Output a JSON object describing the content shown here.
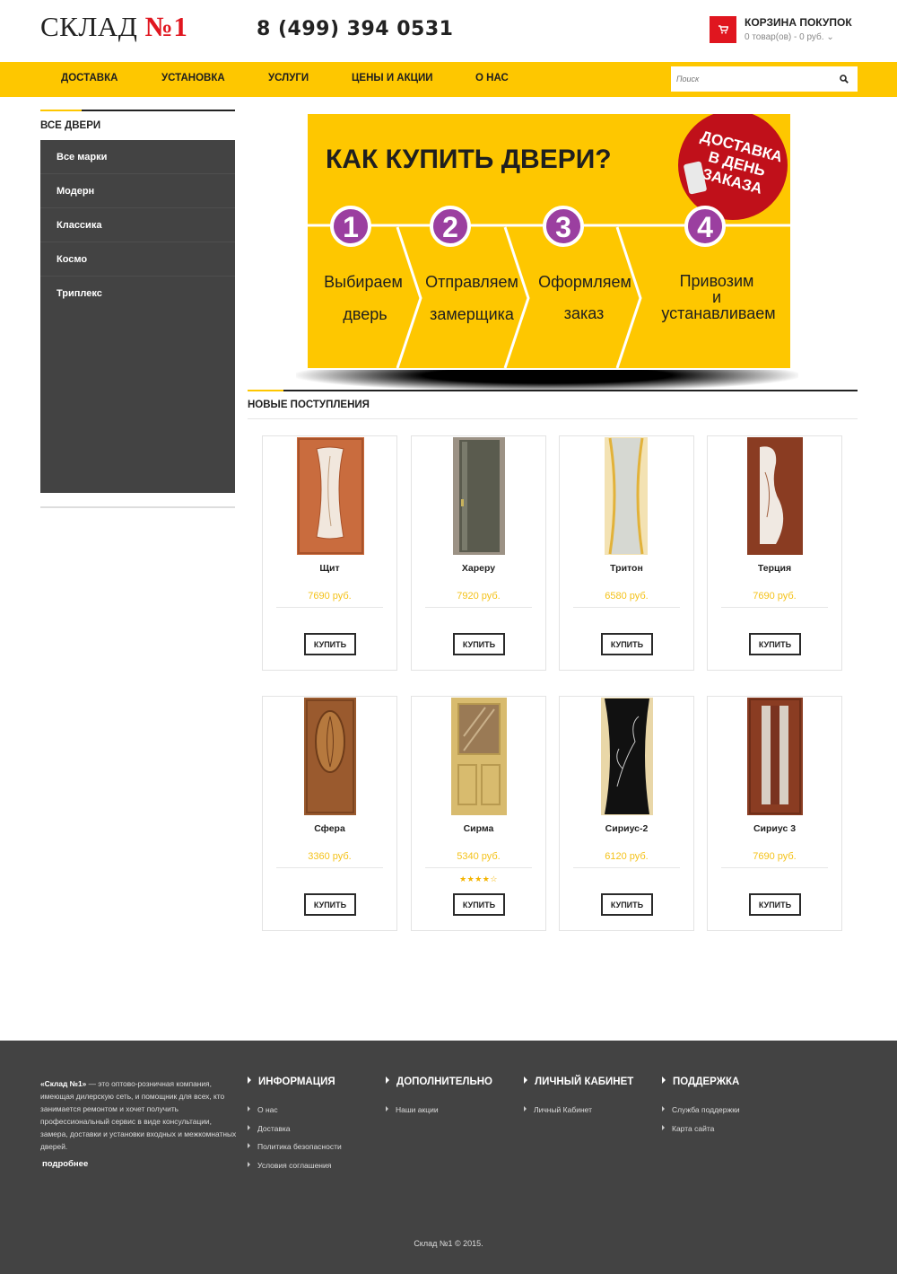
{
  "header": {
    "logo_text": "СКЛАД ",
    "logo_num": "№1",
    "phone": "8 (499) 394 0531",
    "cart_title": "КОРЗИНА ПОКУПОК",
    "cart_summary": "0 товар(ов) - 0 руб.",
    "cart_chevron": "⌄"
  },
  "nav": {
    "items": [
      "ДОСТАВКА",
      "УСТАНОВКА",
      "УСЛУГИ",
      "ЦЕНЫ И АКЦИИ",
      "О НАС"
    ],
    "search_placeholder": "Поиск",
    "search_icon": "search-icon"
  },
  "sidebar": {
    "title": "ВСЕ ДВЕРИ",
    "items": [
      "Все марки",
      "Модерн",
      "Классика",
      "Космо",
      "Триплекс"
    ]
  },
  "banner": {
    "title": "КАК КУПИТЬ ДВЕРИ?",
    "badge": [
      "ДОСТАВКА",
      "В ДЕНЬ",
      "ЗАКАЗА"
    ],
    "steps": [
      {
        "num": "1",
        "lines": [
          "Выбираем",
          "дверь"
        ]
      },
      {
        "num": "2",
        "lines": [
          "Отправляем",
          "замерщика"
        ]
      },
      {
        "num": "3",
        "lines": [
          "Оформляем",
          "заказ"
        ]
      },
      {
        "num": "4",
        "lines": [
          "Привозим",
          "и",
          "устанавливаем"
        ]
      }
    ],
    "colors": {
      "yellow": "#fec700",
      "purple": "#9b3fa0",
      "red": "#c0101a"
    }
  },
  "new_arrivals": {
    "title": "НОВЫЕ ПОСТУПЛЕНИЯ",
    "buy_label": "КУПИТЬ",
    "products": [
      {
        "name": "Щит",
        "price": "7690 руб.",
        "stars": ""
      },
      {
        "name": "Хареру",
        "price": "7920 руб.",
        "stars": ""
      },
      {
        "name": "Тритон",
        "price": "6580 руб.",
        "stars": ""
      },
      {
        "name": "Терция",
        "price": "7690 руб.",
        "stars": ""
      },
      {
        "name": "Сфера",
        "price": "3360 руб.",
        "stars": ""
      },
      {
        "name": "Сирма",
        "price": "5340 руб.",
        "stars": "★★★★☆",
        "rating": 4
      },
      {
        "name": "Сириус-2",
        "price": "6120 руб.",
        "stars": ""
      },
      {
        "name": "Сириус 3",
        "price": "7690 руб.",
        "stars": ""
      }
    ]
  },
  "footer": {
    "about_brand": "«Склад №1»",
    "about_text": " — это оптово-розничная компания, имеющая дилерскую сеть, и помощник для всех, кто занимается ремонтом и хочет получить профессиональный сервис в виде консультации, замера, доставки и установки входных и межкомнатных дверей.",
    "more": "подробнее",
    "columns": [
      {
        "title": "ИНФОРМАЦИЯ",
        "links": [
          "О нас",
          "Доставка",
          "Политика безопасности",
          "Условия соглашения"
        ]
      },
      {
        "title": "ДОПОЛНИТЕЛЬНО",
        "links": [
          "Наши акции"
        ]
      },
      {
        "title": "ЛИЧНЫЙ КАБИНЕТ",
        "links": [
          "Личный Кабинет"
        ]
      },
      {
        "title": "ПОДДЕРЖКА",
        "links": [
          "Служба поддержки",
          "Карта сайта"
        ]
      }
    ],
    "copyright": "Склад №1 © 2015."
  }
}
